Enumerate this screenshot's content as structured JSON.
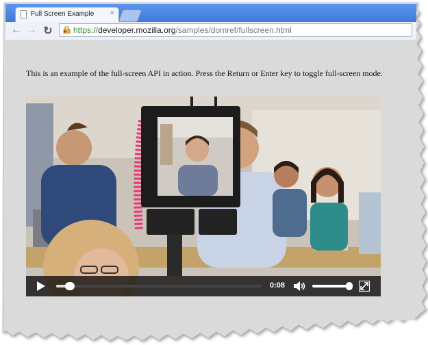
{
  "browser": {
    "tab_title": "Full Screen Example",
    "tab_close": "×",
    "url_scheme": "https://",
    "url_host": "developer.mozilla.org",
    "url_path": "/samples/domref/fullscreen.html"
  },
  "page": {
    "intro_text": "This is an example of the full-screen API in action. Press the Return or Enter key to toggle full-screen mode."
  },
  "video": {
    "time": "0:08",
    "progress_fraction": 0.05,
    "volume_fraction": 0.95
  }
}
